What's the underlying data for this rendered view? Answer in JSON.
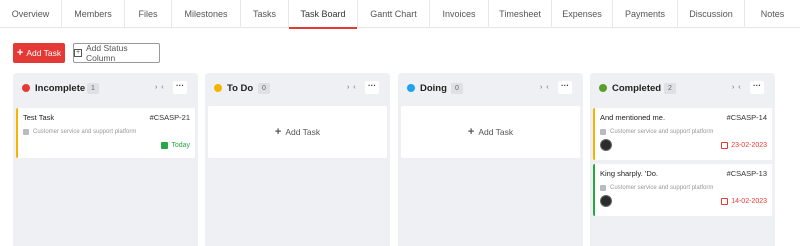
{
  "tabs": [
    "Overview",
    "Members",
    "Files",
    "Milestones",
    "Tasks",
    "Task Board",
    "Gantt Chart",
    "Invoices",
    "Timesheet",
    "Expenses",
    "Payments",
    "Discussion",
    "Notes"
  ],
  "active_tab": "Task Board",
  "actions": {
    "add_task": "Add Task",
    "add_status_column": "Add Status Column"
  },
  "columns": [
    {
      "title": "Incomplete",
      "count": "1",
      "color": "#e53935",
      "collapse": "› ‹",
      "more": "···",
      "cards": [
        {
          "title": "Test Task",
          "code": "#CSASP-21",
          "project": "Customer service and support platform",
          "date": "Today",
          "date_color": "#28a745"
        }
      ]
    },
    {
      "title": "To Do",
      "count": "0",
      "color": "#f4b400",
      "collapse": "› ‹",
      "more": "···",
      "add_label": "Add Task"
    },
    {
      "title": "Doing",
      "count": "0",
      "color": "#1da1f2",
      "collapse": "› ‹",
      "more": "···",
      "add_label": "Add Task"
    },
    {
      "title": "Completed",
      "count": "2",
      "color": "#5a9e2a",
      "collapse": "› ‹",
      "more": "···",
      "cards": [
        {
          "title": "And mentioned me.",
          "code": "#CSASP-14",
          "project": "Customer service and support platform",
          "date": "23-02-2023",
          "date_color": "#e53935",
          "accent": "#f4b400"
        },
        {
          "title": "King sharply. 'Do.",
          "code": "#CSASP-13",
          "project": "Customer service and support platform",
          "date": "14-02-2023",
          "date_color": "#e53935",
          "accent": "#28a745"
        }
      ]
    }
  ]
}
